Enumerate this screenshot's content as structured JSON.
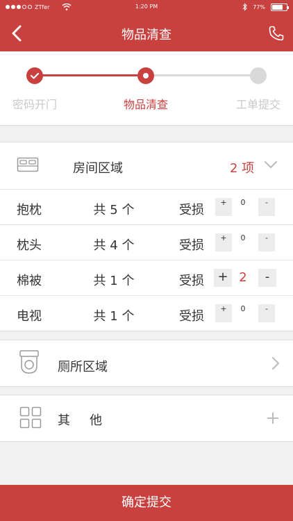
{
  "status_bar": {
    "carrier": "ZTfer",
    "time": "1:20 PM",
    "battery": "77%",
    "battery_level": 0.77
  },
  "nav": {
    "title": "物品清查",
    "back_icon": "chevron-left-icon",
    "phone_icon": "phone-icon"
  },
  "progress": {
    "steps": [
      {
        "label": "密码开门",
        "state": "done"
      },
      {
        "label": "物品清查",
        "state": "current"
      },
      {
        "label": "工单提交",
        "state": "pending"
      }
    ]
  },
  "room_section": {
    "icon": "bed-icon",
    "title": "房间区域",
    "count": "2 项",
    "expanded": true,
    "items": [
      {
        "name": "抱枕",
        "total": "共 5 个",
        "damage_label": "受损",
        "plus": "+",
        "value": "0",
        "minus": "-",
        "active": false
      },
      {
        "name": "枕头",
        "total": "共 4 个",
        "damage_label": "受损",
        "plus": "+",
        "value": "0",
        "minus": "-",
        "active": false
      },
      {
        "name": "棉被",
        "total": "共 1 个",
        "damage_label": "受损",
        "plus": "+",
        "value": "2",
        "minus": "-",
        "active": true
      },
      {
        "name": "电视",
        "total": "共 1 个",
        "damage_label": "受损",
        "plus": "+",
        "value": "0",
        "minus": "-",
        "active": false
      }
    ]
  },
  "toilet_section": {
    "icon": "toilet-icon",
    "title": "厕所区域"
  },
  "other_section": {
    "icon": "grid-icon",
    "title": "其他"
  },
  "submit": {
    "label": "确定提交"
  },
  "colors": {
    "accent": "#c9413f",
    "inactive": "#d9d9d9"
  }
}
